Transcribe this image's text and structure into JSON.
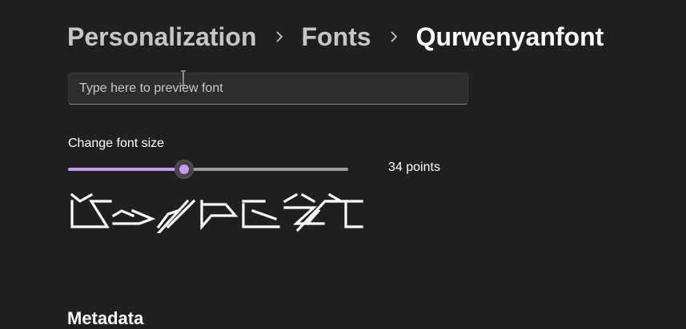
{
  "breadcrumb": {
    "items": [
      "Personalization",
      "Fonts"
    ],
    "current": "Qurwenyanfont"
  },
  "preview": {
    "placeholder": "Type here to preview font",
    "value": ""
  },
  "font_size": {
    "label": "Change font size",
    "value_text": "34 points",
    "slider_fraction": 0.415
  },
  "sample": {
    "glyph_count": 8
  },
  "metadata": {
    "title": "Metadata"
  },
  "colors": {
    "background": "#202020",
    "accent": "#c59bf0",
    "text": "#ffffff",
    "muted_text": "#c6c6c6"
  }
}
